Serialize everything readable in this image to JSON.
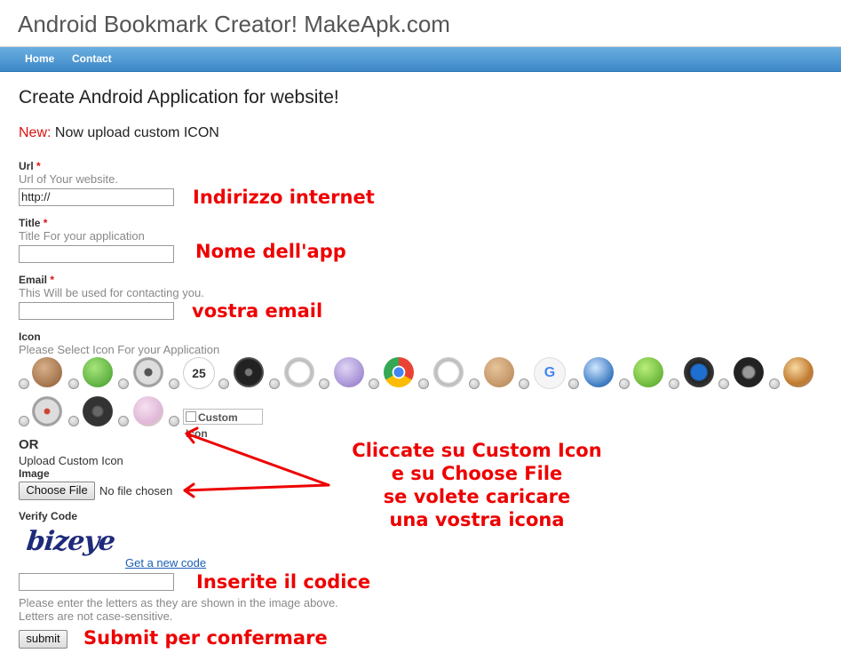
{
  "header": {
    "title": "Android Bookmark Creator! MakeApk.com"
  },
  "nav": {
    "items": [
      "Home",
      "Contact"
    ]
  },
  "main": {
    "heading": "Create Android Application for website!",
    "new_label": "New:",
    "new_text": " Now upload custom ICON",
    "url": {
      "label": "Url",
      "required": "*",
      "hint": "Url of Your website.",
      "value": "http://",
      "annotation": "Indirizzo internet"
    },
    "title": {
      "label": "Title",
      "required": "*",
      "hint": "Title For your application",
      "value": "",
      "annotation": "Nome dell'app"
    },
    "email": {
      "label": "Email",
      "required": "*",
      "hint": "This Will be used for contacting you.",
      "value": "",
      "annotation": "vostra email"
    },
    "icon": {
      "label": "Icon",
      "hint": "Please Select Icon For your Application",
      "icons": [
        "wood-at-icon",
        "android-robot-icon",
        "camera-lens-icon",
        "calendar-icon",
        "black-dial-icon",
        "clock-icon",
        "purple-globe-icon",
        "chrome-icon",
        "clock-icon",
        "wood-badge-icon",
        "google-mail-icon",
        "blue-orb-icon",
        "green-leaf-icon",
        "music-player-icon",
        "headphones-icon",
        "sunset-stack-icon",
        "silver-disc-icon",
        "dark-gear-icon",
        "pastel-stack-icon"
      ],
      "calendar_number": "25",
      "custom_icon_label": "Custom Icon"
    },
    "or_label": "OR",
    "upload_label": "Upload Custom Icon",
    "image_label": "Image",
    "choose_file": "Choose File",
    "no_file": "No file chosen",
    "verify_label": "Verify Code",
    "captcha_text": "bizeye",
    "new_code_link": "Get a new code",
    "code_value": "",
    "code_annotation": "Inserite il codice",
    "code_hint_1": "Please enter the letters as they are shown in the image above.",
    "code_hint_2": "Letters are not case-sensitive.",
    "submit": "submit",
    "submit_annotation": "Submit per confermare",
    "instructions": [
      "Cliccate su Custom Icon",
      "e su Choose File",
      "se volete caricare",
      "una vostra icona"
    ]
  },
  "colors": {
    "annotation": "#ee0000",
    "nav": "#4a95d2",
    "link": "#1a5fb4"
  }
}
